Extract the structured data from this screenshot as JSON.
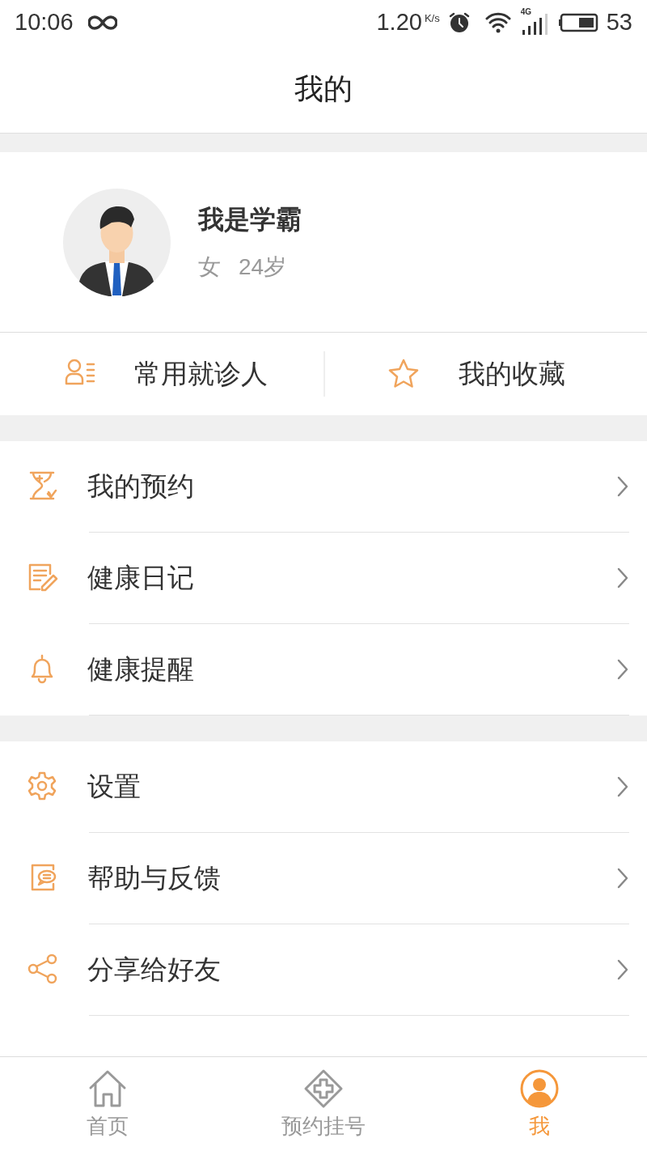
{
  "status_bar": {
    "time": "10:06",
    "speed": "1.20",
    "speed_unit": "K/s",
    "network_type": "4G",
    "battery": "53"
  },
  "header": {
    "title": "我的"
  },
  "profile": {
    "name": "我是学霸",
    "gender": "女",
    "age": "24岁"
  },
  "shortcuts": [
    {
      "kind": "patients",
      "label": "常用就诊人"
    },
    {
      "kind": "star",
      "label": "我的收藏"
    }
  ],
  "menu_groups": [
    [
      {
        "kind": "hourglass",
        "label": "我的预约"
      },
      {
        "kind": "note",
        "label": "健康日记"
      },
      {
        "kind": "bell",
        "label": "健康提醒"
      }
    ],
    [
      {
        "kind": "gear",
        "label": "设置"
      },
      {
        "kind": "feedback",
        "label": "帮助与反馈"
      },
      {
        "kind": "share",
        "label": "分享给好友"
      }
    ]
  ],
  "tab_bar": [
    {
      "kind": "home",
      "label": "首页",
      "selected": false
    },
    {
      "kind": "plus",
      "label": "预约挂号",
      "selected": false
    },
    {
      "kind": "user",
      "label": "我",
      "selected": true
    }
  ]
}
